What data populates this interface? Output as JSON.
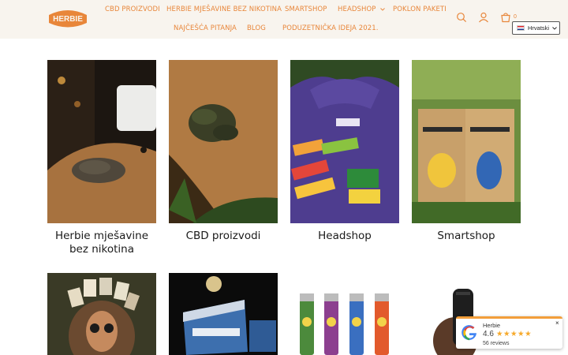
{
  "brand": {
    "logo_text": "HERBIE"
  },
  "nav": {
    "items": [
      {
        "label": "CBD PROIZVODI"
      },
      {
        "label": "HERBIE MJEŠAVINE BEZ NIKOTINA"
      },
      {
        "label": "SMARTSHOP"
      },
      {
        "label": "HEADSHOP"
      },
      {
        "label": "POKLON PAKETI"
      },
      {
        "label": "NAJČEŠĆA PITANJA"
      },
      {
        "label": "BLOG"
      },
      {
        "label": "PODUZETNIČKA IDEJA 2021."
      }
    ]
  },
  "header": {
    "cart_count": "0",
    "language": "Hrvatski"
  },
  "colors": {
    "accent": "#e8863a",
    "header_bg": "#f8f4ee",
    "star": "#f6a92b"
  },
  "collections": [
    {
      "label": "Herbie mješavine bez nikotina",
      "image": "mug-and-herbs-on-wooden-scoop"
    },
    {
      "label": "CBD proizvodi",
      "image": "cbd-buds-on-wooden-scoop"
    },
    {
      "label": "Headshop",
      "image": "purple-hoodie-with-rolling-paper-packs"
    },
    {
      "label": "Smartshop",
      "image": "two-kraft-bags-on-grass"
    },
    {
      "label": "",
      "image": "woman-with-sunglasses-and-product-packs"
    },
    {
      "label": "",
      "image": "rolling-paper-display-box"
    },
    {
      "label": "",
      "image": "four-printed-lighters"
    },
    {
      "label": "",
      "image": "hand-holding-vaporizer"
    }
  ],
  "review_widget": {
    "name": "Herbie",
    "rating": "4.6",
    "stars": "★★★★★",
    "count": "56 reviews",
    "close": "×"
  }
}
